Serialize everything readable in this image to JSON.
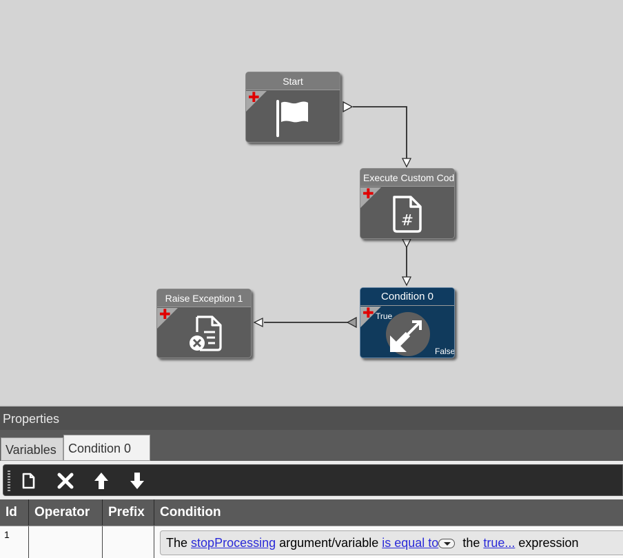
{
  "workflow": {
    "nodes": {
      "start": {
        "title": "Start",
        "icon": "flag-icon"
      },
      "execute": {
        "title": "Execute Custom Code",
        "icon": "hash-document-icon"
      },
      "condition": {
        "title": "Condition 0",
        "icon": "branch-arrows-icon",
        "true_label": "True",
        "false_label": "False"
      },
      "raise": {
        "title": "Raise Exception 1",
        "icon": "error-document-icon"
      }
    },
    "colors": {
      "canvas": "#d4d4d4",
      "node": "#5c5c5c",
      "condition_node": "#103a5c",
      "add_port": "#e00000"
    }
  },
  "properties": {
    "header": "Properties",
    "tabs": [
      {
        "label": "Variables"
      },
      {
        "label": "Condition 0"
      }
    ],
    "toolbar": {
      "new": "new-document-icon",
      "delete": "delete-x-icon",
      "up": "arrow-up-icon",
      "down": "arrow-down-icon"
    },
    "grid": {
      "columns": [
        "Id",
        "Operator",
        "Prefix",
        "Condition"
      ],
      "rows": [
        {
          "id": "1",
          "operator": "",
          "prefix": "",
          "condition": {
            "t1": "The",
            "variable": "stopProcessing",
            "t2": "argument/variable",
            "comparison": "is equal to",
            "t3": "the",
            "value": "true...",
            "t4": "expression"
          }
        }
      ]
    }
  }
}
